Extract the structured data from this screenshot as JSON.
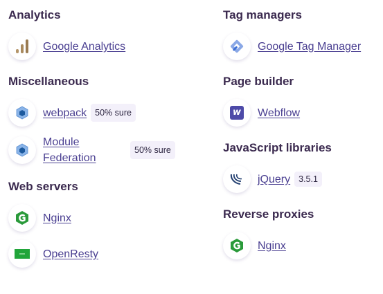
{
  "left": {
    "sections": [
      {
        "title": "Analytics",
        "items": [
          {
            "name": "Google Analytics",
            "icon": "google-analytics-icon"
          }
        ]
      },
      {
        "title": "Miscellaneous",
        "items": [
          {
            "name": "webpack",
            "icon": "webpack-icon",
            "badge": "50% sure"
          },
          {
            "name": "Module Federation",
            "icon": "webpack-icon",
            "badge": "50% sure"
          }
        ]
      },
      {
        "title": "Web servers",
        "items": [
          {
            "name": "Nginx",
            "icon": "nginx-icon"
          },
          {
            "name": "OpenResty",
            "icon": "openresty-icon"
          }
        ]
      }
    ]
  },
  "right": {
    "sections": [
      {
        "title": "Tag managers",
        "items": [
          {
            "name": "Google Tag Manager",
            "icon": "google-tag-manager-icon"
          }
        ]
      },
      {
        "title": "Page builder",
        "items": [
          {
            "name": "Webflow",
            "icon": "webflow-icon",
            "icon_letter": "w"
          }
        ]
      },
      {
        "title": "JavaScript libraries",
        "items": [
          {
            "name": "jQuery",
            "icon": "jquery-icon",
            "version": "3.5.1"
          }
        ]
      },
      {
        "title": "Reverse proxies",
        "items": [
          {
            "name": "Nginx",
            "icon": "nginx-icon"
          }
        ]
      }
    ]
  },
  "colors": {
    "link": "#4a3f91",
    "heading": "#3b2a4f",
    "badge_bg": "#f3f0fa",
    "nginx_green": "#2a9a3a",
    "webflow_purple": "#4d4aa8"
  }
}
